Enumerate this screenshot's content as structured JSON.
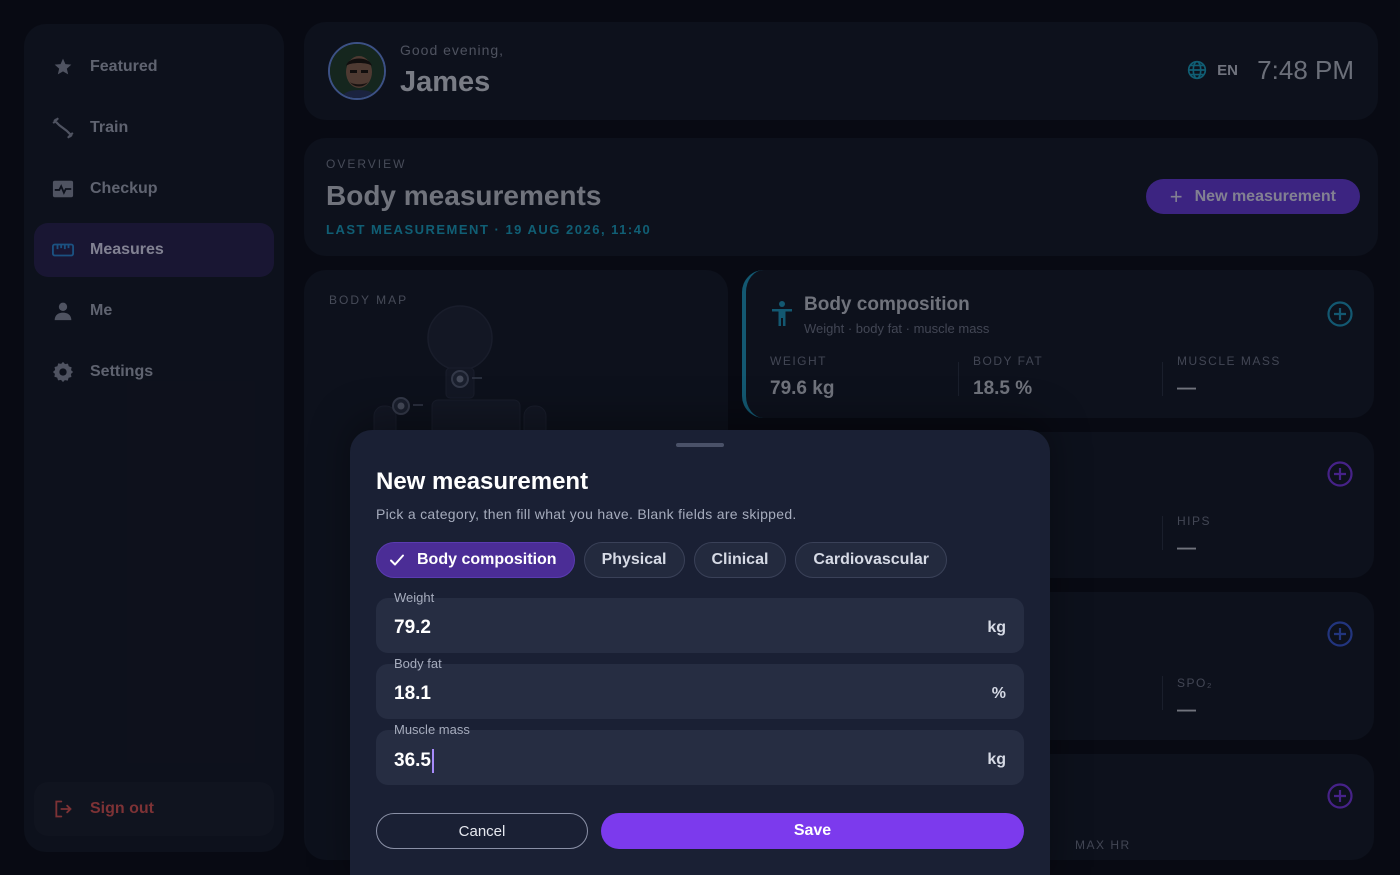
{
  "sidebar": {
    "items": [
      {
        "label": "Featured",
        "icon": "star-icon"
      },
      {
        "label": "Train",
        "icon": "dumbbell-icon"
      },
      {
        "label": "Checkup",
        "icon": "heart-monitor-icon"
      },
      {
        "label": "Measures",
        "icon": "ruler-icon",
        "active": true
      },
      {
        "label": "Me",
        "icon": "person-icon"
      },
      {
        "label": "Settings",
        "icon": "gear-icon"
      }
    ],
    "signout_label": "Sign out"
  },
  "header": {
    "greeting": "Good evening,",
    "name": "James",
    "language": "EN",
    "time": "7:48 PM"
  },
  "overview": {
    "label": "OVERVIEW",
    "title": "Body measurements",
    "last": "LAST MEASUREMENT · 19 AUG 2026, 11:40",
    "new_button": "New measurement"
  },
  "body_map": {
    "label": "BODY MAP"
  },
  "cards": {
    "body_composition": {
      "title": "Body composition",
      "subtitle": "Weight · body fat · muscle mass",
      "metrics": [
        {
          "label": "WEIGHT",
          "value": "79.6 kg"
        },
        {
          "label": "BODY FAT",
          "value": "18.5 %"
        },
        {
          "label": "MUSCLE MASS",
          "value": "—"
        }
      ]
    },
    "physical": {
      "metric_label": "HIPS",
      "metric_value": "—"
    },
    "clinical": {
      "metric_label": "SPO₂",
      "metric_value": "—"
    },
    "cardiovascular": {
      "metric_label": "MAX HR"
    }
  },
  "modal": {
    "title": "New measurement",
    "subtitle": "Pick a category, then fill what you have. Blank fields are skipped.",
    "chips": [
      "Body composition",
      "Physical",
      "Clinical",
      "Cardiovascular"
    ],
    "selected_chip": "Body composition",
    "fields": [
      {
        "label": "Weight",
        "value": "79.2",
        "unit": "kg"
      },
      {
        "label": "Body fat",
        "value": "18.1",
        "unit": "%"
      },
      {
        "label": "Muscle mass",
        "value": "36.5",
        "unit": "kg"
      }
    ],
    "cancel_label": "Cancel",
    "save_label": "Save"
  },
  "colors": {
    "accent": "#7c3aed",
    "teal": "#1f9cc4",
    "danger": "#e05757",
    "background": "#0b0e18"
  }
}
